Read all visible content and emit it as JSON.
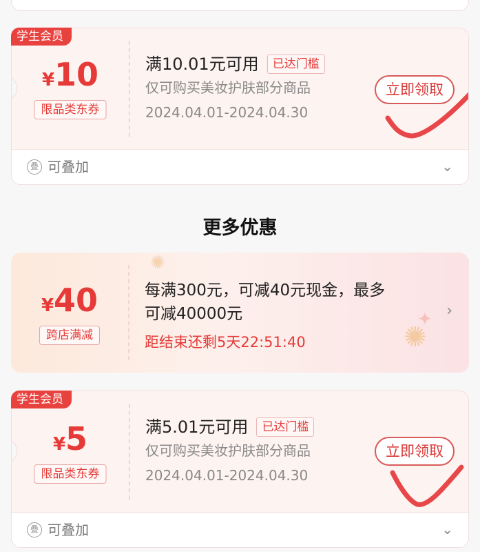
{
  "coupons": [
    {
      "badge": "学生会员",
      "currency": "¥",
      "amount": "10",
      "type_tag": "限品类东券",
      "condition": "满10.01元可用",
      "reached": "已达门槛",
      "scope": "仅可购买美妆护肤部分商品",
      "valid": "2024.04.01-2024.04.30",
      "claim_label": "立即领取",
      "stackable": "可叠加",
      "stack_icon": "叠"
    },
    {
      "badge": "学生会员",
      "currency": "¥",
      "amount": "5",
      "type_tag": "限品类东券",
      "condition": "满5.01元可用",
      "reached": "已达门槛",
      "scope": "仅可购买美妆护肤部分商品",
      "valid": "2024.04.01-2024.04.30",
      "claim_label": "立即领取",
      "stackable": "可叠加",
      "stack_icon": "叠"
    }
  ],
  "section_title": "更多优惠",
  "promo": {
    "currency": "¥",
    "amount": "40",
    "type_tag": "跨店满减",
    "desc_line1": "每满300元，可减40元现金，最多",
    "desc_line2": "可减40000元",
    "countdown": "距结束还剩5天22:51:40"
  },
  "colors": {
    "accent": "#e53a37",
    "check_mark": "#e8474a",
    "badge_bg": "#e8423f"
  },
  "icons": {
    "expand": "chevron-down-icon",
    "promo_arrow": "chevron-right-icon",
    "stack": "stackable-icon"
  }
}
